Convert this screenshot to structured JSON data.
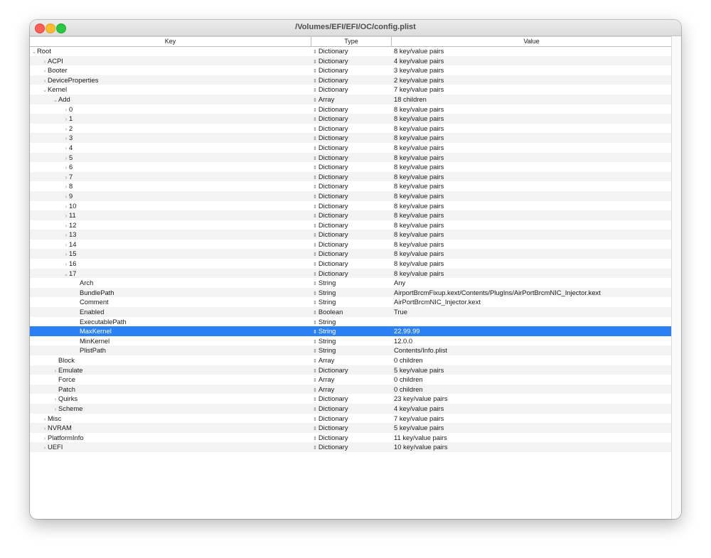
{
  "window": {
    "title": "/Volumes/EFI/EFI/OC/config.plist"
  },
  "columns": {
    "key": "Key",
    "type": "Type",
    "value": "Value"
  },
  "glyphs": {
    "collapsed": "›",
    "expanded": "⌄",
    "type_popup": "⇕"
  },
  "selected_row": 29,
  "rows": [
    {
      "key": "Root",
      "indent": 0,
      "disclosure": "expanded",
      "type": "Dictionary",
      "value": "8 key/value pairs"
    },
    {
      "key": "ACPI",
      "indent": 1,
      "disclosure": "collapsed",
      "type": "Dictionary",
      "value": "4 key/value pairs"
    },
    {
      "key": "Booter",
      "indent": 1,
      "disclosure": "collapsed",
      "type": "Dictionary",
      "value": "3 key/value pairs"
    },
    {
      "key": "DeviceProperties",
      "indent": 1,
      "disclosure": "collapsed",
      "type": "Dictionary",
      "value": "2 key/value pairs"
    },
    {
      "key": "Kernel",
      "indent": 1,
      "disclosure": "expanded",
      "type": "Dictionary",
      "value": "7 key/value pairs"
    },
    {
      "key": "Add",
      "indent": 2,
      "disclosure": "expanded",
      "type": "Array",
      "value": "18 children"
    },
    {
      "key": "0",
      "indent": 3,
      "disclosure": "collapsed",
      "type": "Dictionary",
      "value": "8 key/value pairs"
    },
    {
      "key": "1",
      "indent": 3,
      "disclosure": "collapsed",
      "type": "Dictionary",
      "value": "8 key/value pairs"
    },
    {
      "key": "2",
      "indent": 3,
      "disclosure": "collapsed",
      "type": "Dictionary",
      "value": "8 key/value pairs"
    },
    {
      "key": "3",
      "indent": 3,
      "disclosure": "collapsed",
      "type": "Dictionary",
      "value": "8 key/value pairs"
    },
    {
      "key": "4",
      "indent": 3,
      "disclosure": "collapsed",
      "type": "Dictionary",
      "value": "8 key/value pairs"
    },
    {
      "key": "5",
      "indent": 3,
      "disclosure": "collapsed",
      "type": "Dictionary",
      "value": "8 key/value pairs"
    },
    {
      "key": "6",
      "indent": 3,
      "disclosure": "collapsed",
      "type": "Dictionary",
      "value": "8 key/value pairs"
    },
    {
      "key": "7",
      "indent": 3,
      "disclosure": "collapsed",
      "type": "Dictionary",
      "value": "8 key/value pairs"
    },
    {
      "key": "8",
      "indent": 3,
      "disclosure": "collapsed",
      "type": "Dictionary",
      "value": "8 key/value pairs"
    },
    {
      "key": "9",
      "indent": 3,
      "disclosure": "collapsed",
      "type": "Dictionary",
      "value": "8 key/value pairs"
    },
    {
      "key": "10",
      "indent": 3,
      "disclosure": "collapsed",
      "type": "Dictionary",
      "value": "8 key/value pairs"
    },
    {
      "key": "11",
      "indent": 3,
      "disclosure": "collapsed",
      "type": "Dictionary",
      "value": "8 key/value pairs"
    },
    {
      "key": "12",
      "indent": 3,
      "disclosure": "collapsed",
      "type": "Dictionary",
      "value": "8 key/value pairs"
    },
    {
      "key": "13",
      "indent": 3,
      "disclosure": "collapsed",
      "type": "Dictionary",
      "value": "8 key/value pairs"
    },
    {
      "key": "14",
      "indent": 3,
      "disclosure": "collapsed",
      "type": "Dictionary",
      "value": "8 key/value pairs"
    },
    {
      "key": "15",
      "indent": 3,
      "disclosure": "collapsed",
      "type": "Dictionary",
      "value": "8 key/value pairs"
    },
    {
      "key": "16",
      "indent": 3,
      "disclosure": "collapsed",
      "type": "Dictionary",
      "value": "8 key/value pairs"
    },
    {
      "key": "17",
      "indent": 3,
      "disclosure": "expanded",
      "type": "Dictionary",
      "value": "8 key/value pairs"
    },
    {
      "key": "Arch",
      "indent": 4,
      "disclosure": "none",
      "type": "String",
      "value": "Any"
    },
    {
      "key": "BundlePath",
      "indent": 4,
      "disclosure": "none",
      "type": "String",
      "value": "AirportBrcmFixup.kext/Contents/PlugIns/AirPortBrcmNIC_Injector.kext"
    },
    {
      "key": "Comment",
      "indent": 4,
      "disclosure": "none",
      "type": "String",
      "value": "AirPortBrcmNIC_Injector.kext"
    },
    {
      "key": "Enabled",
      "indent": 4,
      "disclosure": "none",
      "type": "Boolean",
      "value": "True"
    },
    {
      "key": "ExecutablePath",
      "indent": 4,
      "disclosure": "none",
      "type": "String",
      "value": ""
    },
    {
      "key": "MaxKernel",
      "indent": 4,
      "disclosure": "none",
      "type": "String",
      "value": "22.99.99"
    },
    {
      "key": "MinKernel",
      "indent": 4,
      "disclosure": "none",
      "type": "String",
      "value": "12.0.0"
    },
    {
      "key": "PlistPath",
      "indent": 4,
      "disclosure": "none",
      "type": "String",
      "value": "Contents/Info.plist"
    },
    {
      "key": "Block",
      "indent": 2,
      "disclosure": "none",
      "type": "Array",
      "value": "0 children"
    },
    {
      "key": "Emulate",
      "indent": 2,
      "disclosure": "collapsed",
      "type": "Dictionary",
      "value": "5 key/value pairs"
    },
    {
      "key": "Force",
      "indent": 2,
      "disclosure": "none",
      "type": "Array",
      "value": "0 children"
    },
    {
      "key": "Patch",
      "indent": 2,
      "disclosure": "none",
      "type": "Array",
      "value": "0 children"
    },
    {
      "key": "Quirks",
      "indent": 2,
      "disclosure": "collapsed",
      "type": "Dictionary",
      "value": "23 key/value pairs"
    },
    {
      "key": "Scheme",
      "indent": 2,
      "disclosure": "collapsed",
      "type": "Dictionary",
      "value": "4 key/value pairs"
    },
    {
      "key": "Misc",
      "indent": 1,
      "disclosure": "collapsed",
      "type": "Dictionary",
      "value": "7 key/value pairs"
    },
    {
      "key": "NVRAM",
      "indent": 1,
      "disclosure": "collapsed",
      "type": "Dictionary",
      "value": "5 key/value pairs"
    },
    {
      "key": "PlatformInfo",
      "indent": 1,
      "disclosure": "collapsed",
      "type": "Dictionary",
      "value": "11 key/value pairs"
    },
    {
      "key": "UEFI",
      "indent": 1,
      "disclosure": "collapsed",
      "type": "Dictionary",
      "value": "10 key/value pairs"
    }
  ]
}
